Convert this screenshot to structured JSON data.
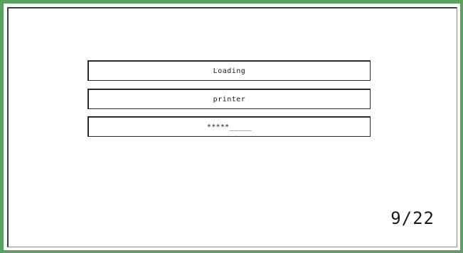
{
  "frame": {
    "accent_color": "#5aa05e"
  },
  "fields": {
    "status_text": "Loading",
    "name_text": "printer",
    "password_text": "*****_____"
  },
  "pager": {
    "counter": "9/22"
  }
}
